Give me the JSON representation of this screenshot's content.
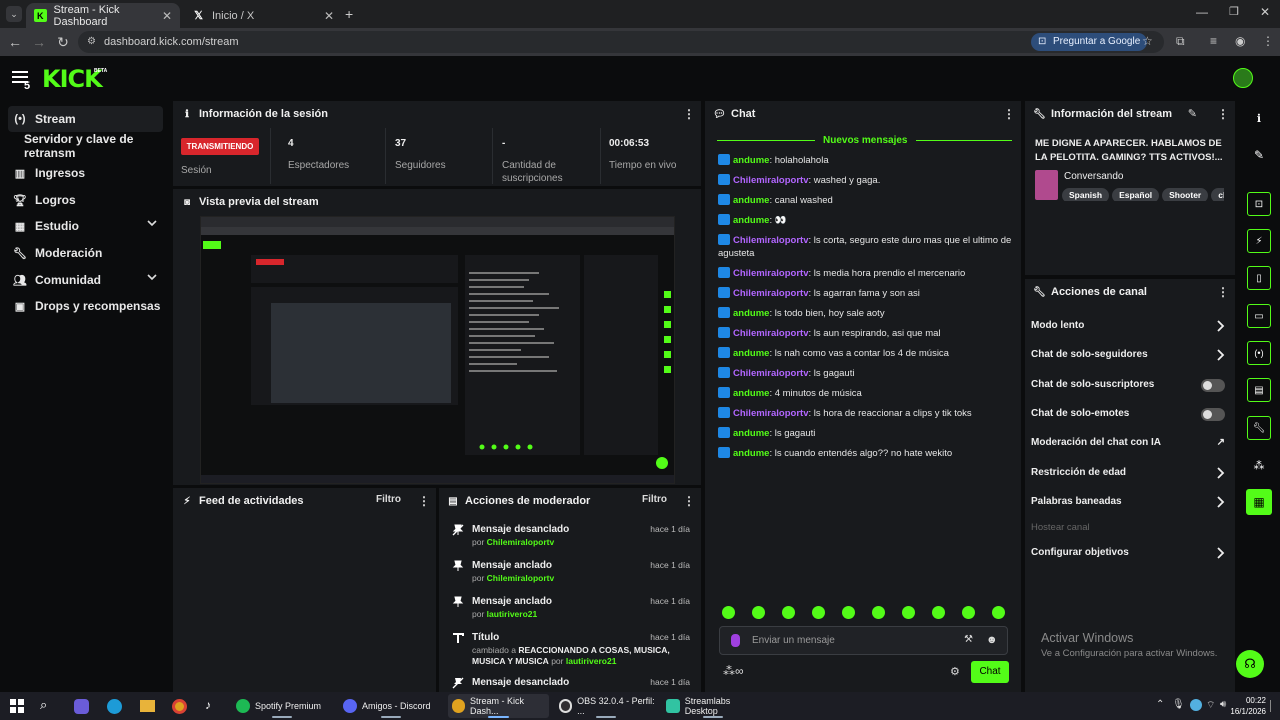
{
  "browser": {
    "tabs": [
      {
        "title": "Stream - Kick Dashboard"
      },
      {
        "title": "Inicio / X"
      }
    ],
    "url": "dashboard.kick.com/stream",
    "ask_google": "Preguntar a Google"
  },
  "brand": {
    "logo_text": "KICK",
    "beta": "BETA",
    "badge_count": "5",
    "accent": "#53fc18"
  },
  "sidebar": {
    "items": [
      {
        "label": "Stream",
        "icon": "broadcast-icon"
      },
      {
        "label": "Servidor y clave de retransm"
      },
      {
        "label": "Ingresos",
        "icon": "chart-icon"
      },
      {
        "label": "Logros",
        "icon": "trophy-icon"
      },
      {
        "label": "Estudio",
        "icon": "studio-icon"
      },
      {
        "label": "Moderación",
        "icon": "wrench-icon"
      },
      {
        "label": "Comunidad",
        "icon": "people-icon"
      },
      {
        "label": "Drops y recompensas",
        "icon": "grid-icon"
      }
    ]
  },
  "session": {
    "title": "Información de la sesión",
    "status": "TRANSMITIENDO",
    "status_label": "Sesión",
    "viewers": "4",
    "viewers_label": "Espectadores",
    "followers": "37",
    "followers_label": "Seguidores",
    "subs": "-",
    "subs_label": "Cantidad de suscripciones",
    "uptime": "00:06:53",
    "uptime_label": "Tiempo en vivo"
  },
  "preview": {
    "title": "Vista previa del stream"
  },
  "activity": {
    "title": "Feed de actividades",
    "filter": "Filtro"
  },
  "modactions": {
    "title": "Acciones de moderador",
    "filter": "Filtro",
    "items": [
      {
        "title": "Mensaje desanclado",
        "prefix": "por",
        "user": "Chilemiraloportv",
        "time": "hace 1 día"
      },
      {
        "title": "Mensaje anclado",
        "prefix": "por",
        "user": "Chilemiraloportv",
        "time": "hace 1 día"
      },
      {
        "title": "Mensaje anclado",
        "prefix": "por",
        "user": "lautirivero21",
        "time": "hace 1 día"
      },
      {
        "title": "Título",
        "prefix": "cambiado a",
        "value": "REACCIONANDO A COSAS, MUSICA, MUSICA Y MUSICA",
        "by": "por",
        "user": "lautirivero21",
        "time": "hace 1 día"
      },
      {
        "title": "Mensaje desanclado",
        "time": "hace 1 día"
      }
    ]
  },
  "chat": {
    "title": "Chat",
    "new_messages": "Nuevos mensajes",
    "messages": [
      {
        "user": "andume",
        "text": "holaholahola"
      },
      {
        "user": "Chilemiraloportv",
        "text": "washed y gaga."
      },
      {
        "user": "andume",
        "text": "canal washed"
      },
      {
        "user": "andume",
        "text": "👀"
      },
      {
        "user": "Chilemiraloportv",
        "text": "ls corta, seguro este duro mas que el ultimo de agusteta"
      },
      {
        "user": "Chilemiraloportv",
        "text": "ls media hora prendio el mercenario"
      },
      {
        "user": "Chilemiraloportv",
        "text": "ls agarran fama y son asi"
      },
      {
        "user": "andume",
        "text": "ls todo bien, hoy sale aoty"
      },
      {
        "user": "Chilemiraloportv",
        "text": "ls aun respirando, asi que mal"
      },
      {
        "user": "andume",
        "text": "ls nah como vas a contar los 4 de música"
      },
      {
        "user": "Chilemiraloportv",
        "text": "ls gagauti"
      },
      {
        "user": "andume",
        "text": "4 minutos de música"
      },
      {
        "user": "Chilemiraloportv",
        "text": "ls hora de reaccionar a clips y tik toks"
      },
      {
        "user": "andume",
        "text": "ls gagauti"
      },
      {
        "user": "andume",
        "text": "ls cuando entendés algo?? no hate wekito"
      }
    ],
    "input_placeholder": "Enviar un mensaje",
    "send": "Chat"
  },
  "streaminfo": {
    "title": "Información del stream",
    "stream_title": "ME DIGNE A APARECER. HABLAMOS DE LA PELOTITA. GAMING? TTS ACTIVOS!...",
    "category": "Conversando",
    "tags": [
      "Spanish",
      "Español",
      "Shooter",
      "chill"
    ]
  },
  "channel_actions": {
    "title": "Acciones de canal",
    "items": [
      {
        "label": "Modo lento",
        "control": "arrow"
      },
      {
        "label": "Chat de solo-seguidores",
        "control": "arrow"
      },
      {
        "label": "Chat de solo-suscriptores",
        "control": "toggle",
        "on": false
      },
      {
        "label": "Chat de solo-emotes",
        "control": "toggle",
        "on": false
      },
      {
        "label": "Moderación del chat con IA",
        "control": "external"
      },
      {
        "label": "Restricción de edad",
        "control": "arrow"
      },
      {
        "label": "Palabras baneadas",
        "control": "arrow"
      },
      {
        "label": "Hostear canal",
        "control": "none",
        "disabled": true
      },
      {
        "label": "Configurar objetivos",
        "control": "arrow"
      }
    ]
  },
  "activate_windows": {
    "title": "Activar Windows",
    "subtitle": "Ve a Configuración para activar Windows."
  },
  "taskbar": {
    "apps": [
      {
        "label": "Spotify Premium"
      },
      {
        "label": "Amigos - Discord"
      },
      {
        "label": "Stream - Kick Dash..."
      },
      {
        "label": "OBS 32.0.4 - Perfil: ..."
      },
      {
        "label": "Streamlabs Desktop"
      }
    ],
    "time": "00:22",
    "date": "16/1/2026"
  }
}
